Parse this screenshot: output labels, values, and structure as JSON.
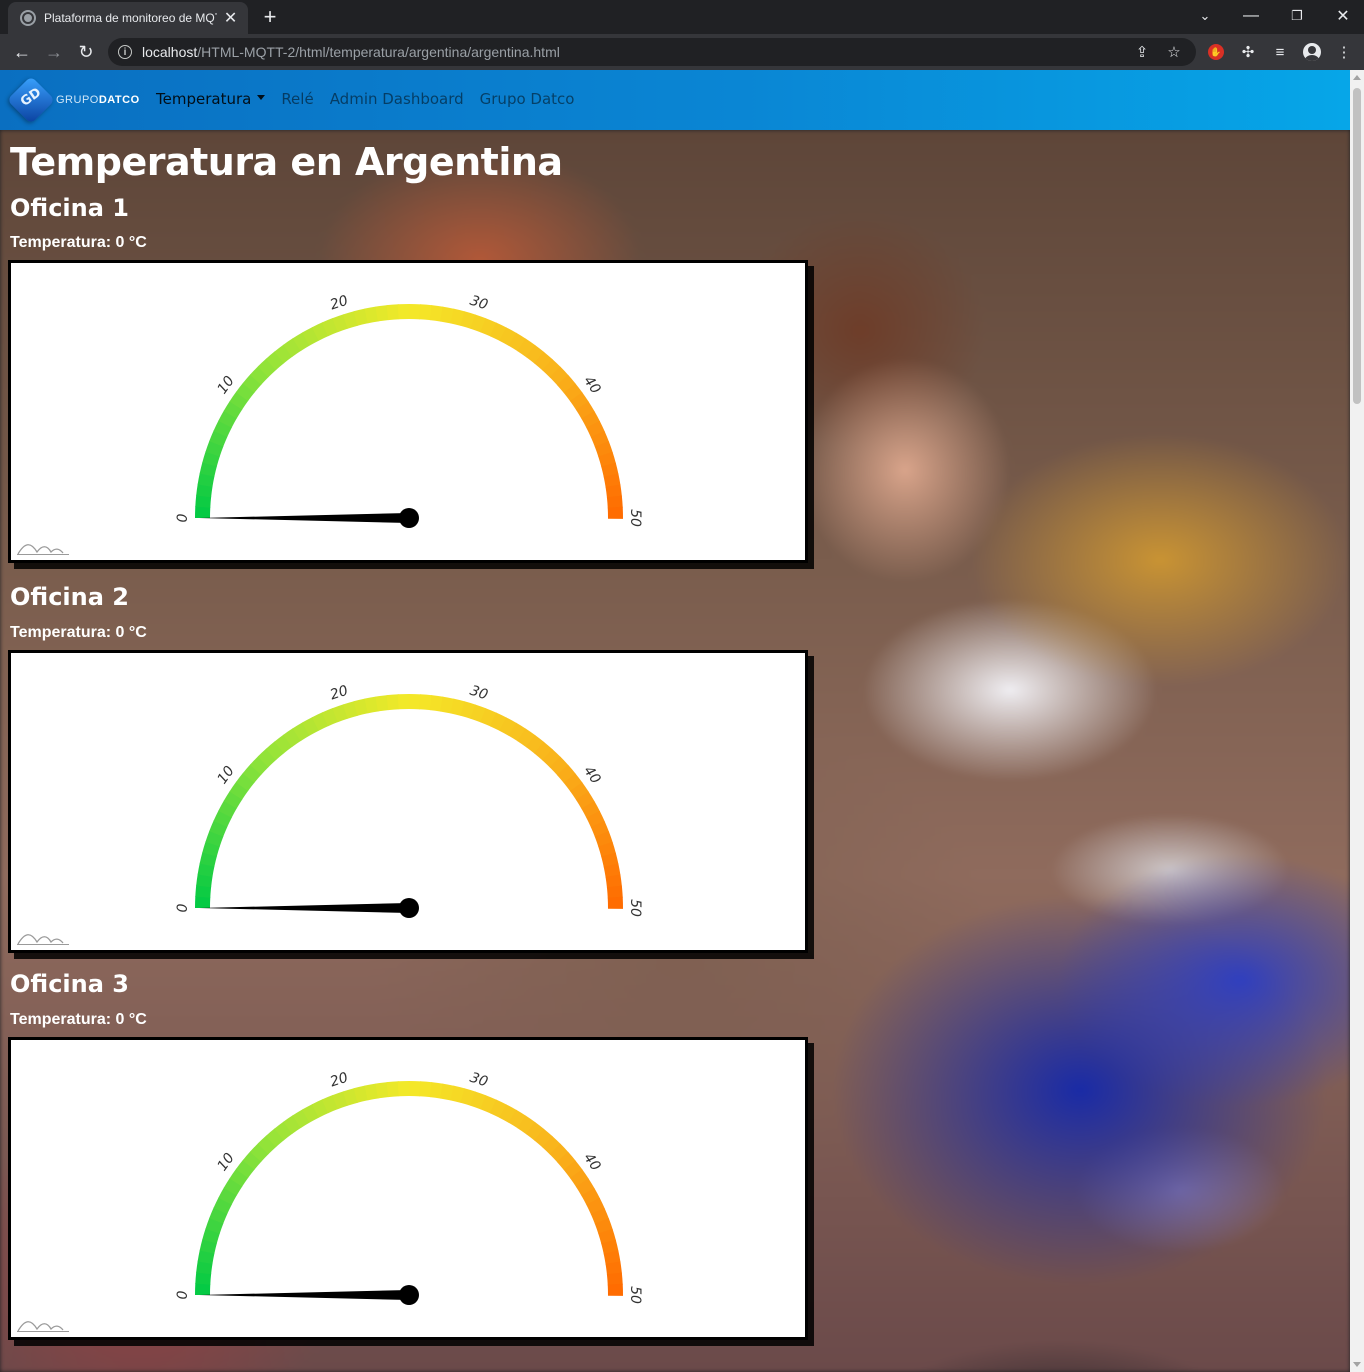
{
  "browser": {
    "tab_title": "Plataforma de monitoreo de MQTT",
    "url_host": "localhost",
    "url_path": "/HTML-MQTT-2/html/temperatura/argentina/argentina.html"
  },
  "navbar": {
    "brand_light": "GRUPO",
    "brand_bold": "DATCO",
    "logo_letters": "GD",
    "items": [
      {
        "label": "Temperatura",
        "dropdown": true,
        "active": true
      },
      {
        "label": "Relé"
      },
      {
        "label": "Admin Dashboard"
      },
      {
        "label": "Grupo Datco"
      }
    ]
  },
  "page": {
    "title": "Temperatura en Argentina"
  },
  "gauge_scale": {
    "min": 0,
    "max": 50,
    "ticks": [
      "0",
      "10",
      "20",
      "30",
      "40",
      "50"
    ],
    "colors": [
      "#00c944",
      "#8fe33a",
      "#f4e928",
      "#f9b31c",
      "#ff6a00"
    ]
  },
  "offices": [
    {
      "name": "Oficina 1",
      "temp_label": "Temperatura: 0 °C",
      "value": 0
    },
    {
      "name": "Oficina 2",
      "temp_label": "Temperatura: 0 °C",
      "value": 0
    },
    {
      "name": "Oficina 3",
      "temp_label": "Temperatura: 0 °C",
      "value": 0
    }
  ]
}
